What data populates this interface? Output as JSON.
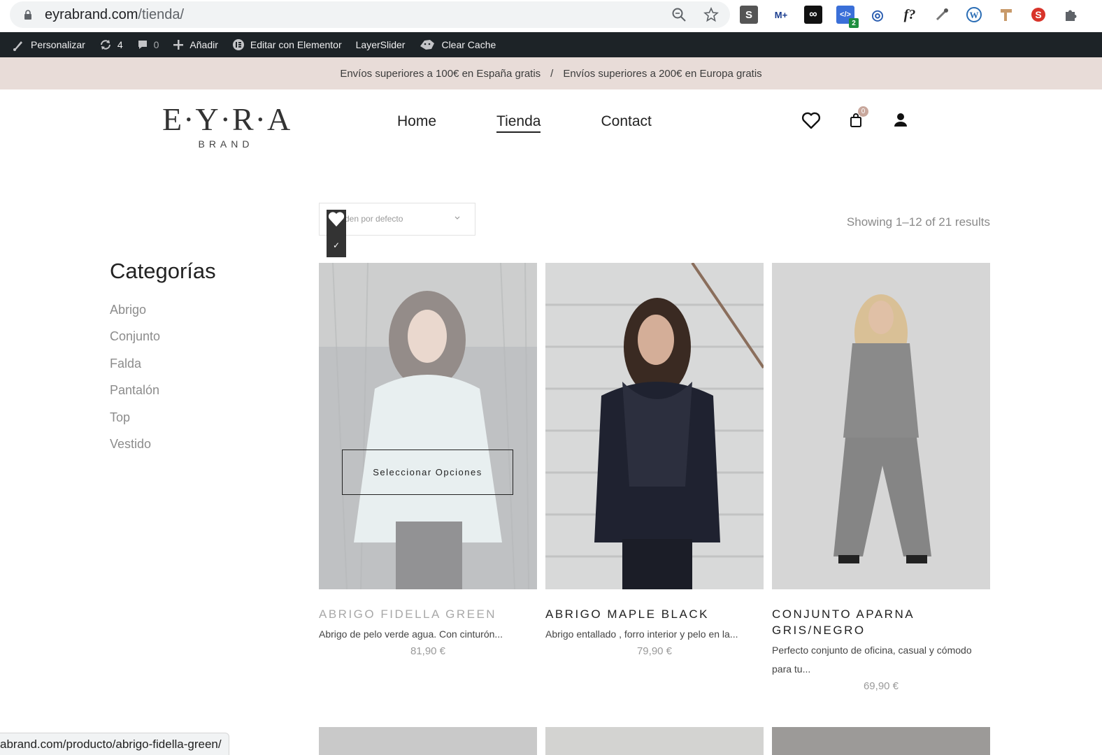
{
  "browser": {
    "url_host": "eyrabrand.com",
    "url_path": "/tienda/",
    "status_url": "abrand.com/producto/abrigo-fidella-green/",
    "extensions": [
      "S",
      "M+",
      "∞",
      "</>",
      "◎",
      "f?",
      "eyedropper-icon",
      "wordpress-icon",
      "tool-icon",
      "seo-icon",
      "puzzle-icon"
    ],
    "ext_badge": "2"
  },
  "adminbar": {
    "customize": "Personalizar",
    "updates_count": "4",
    "comments_count": "0",
    "add_new": "Añadir",
    "elementor": "Editar con Elementor",
    "layerslider": "LayerSlider",
    "clear_cache": "Clear Cache"
  },
  "banner": {
    "left": "Envíos superiores a 100€ en España gratis",
    "separator": "/",
    "right": "Envíos superiores a 200€ en Europa gratis"
  },
  "header": {
    "logo_main": "E·Y·R·A",
    "logo_sub": "BRAND",
    "nav": [
      {
        "label": "Home",
        "active": false
      },
      {
        "label": "Tienda",
        "active": true
      },
      {
        "label": "Contact",
        "active": false
      }
    ],
    "cart_count": "0"
  },
  "shop": {
    "sort_label": "den por defecto",
    "results_text": "Showing 1–12 of 21 results",
    "check": "✓"
  },
  "sidebar": {
    "title": "Categorías",
    "categories": [
      "Abrigo",
      "Conjunto",
      "Falda",
      "Pantalón",
      "Top",
      "Vestido"
    ]
  },
  "products": [
    {
      "name": "ABRIGO FIDELLA GREEN",
      "desc": "Abrigo de pelo verde agua. Con cinturón...",
      "price": "81,90 €",
      "button": "Seleccionar Opciones"
    },
    {
      "name": "ABRIGO MAPLE BLACK",
      "desc": "Abrigo entallado , forro interior y pelo en la...",
      "price": "79,90 €"
    },
    {
      "name": "CONJUNTO APARNA GRIS/NEGRO",
      "desc": "Perfecto conjunto de oficina, casual y cómodo para tu...",
      "price": "69,90 €"
    }
  ],
  "colors": {
    "adminbar": "#1d2327",
    "banner": "#e8dcd8",
    "accent_badge": "#c8a79c"
  }
}
